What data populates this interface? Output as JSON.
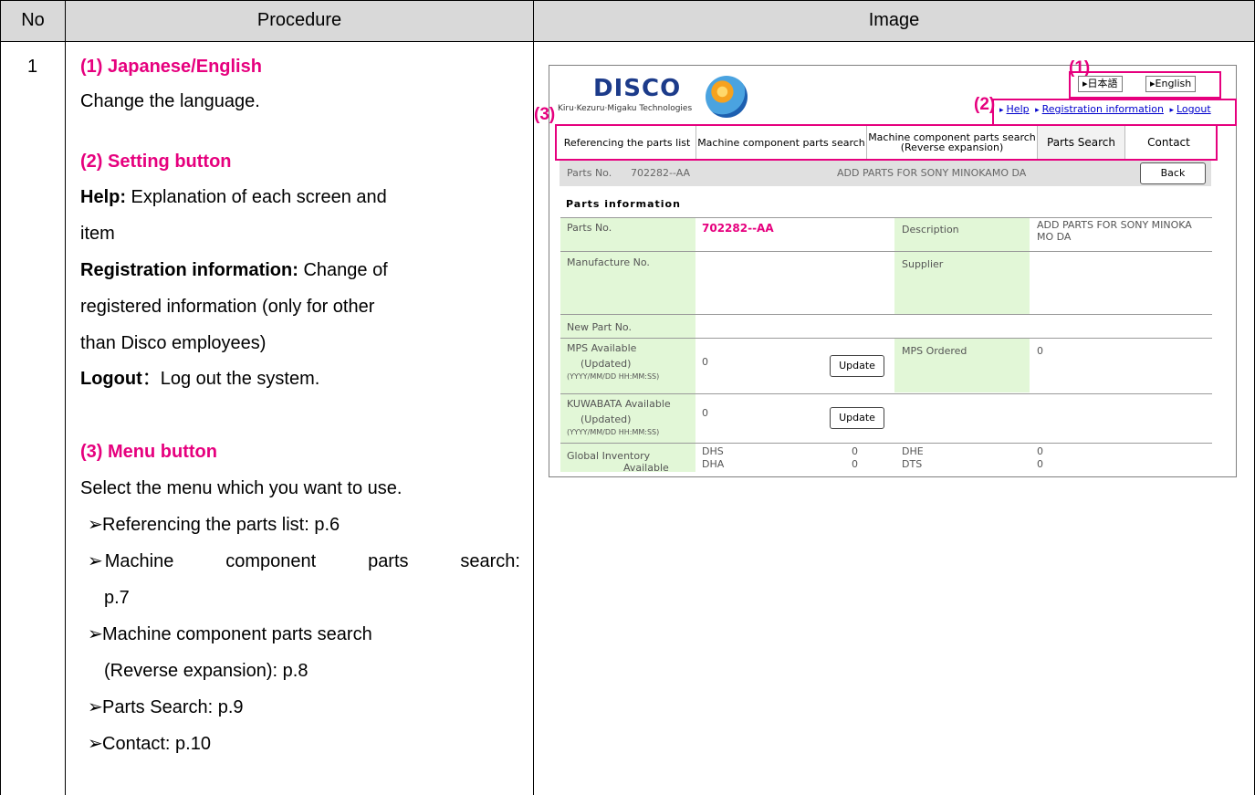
{
  "header": {
    "no": "No",
    "procedure": "Procedure",
    "image": "Image"
  },
  "row": {
    "no": "1",
    "s1_title": "(1) Japanese/English",
    "s1_text": "Change the language.",
    "s2_title": "(2) Setting button",
    "help_label": "Help:",
    "help_text": " Explanation of each screen and",
    "help_text2": "item",
    "reg_label": "Registration information:",
    "reg_text": " Change of",
    "reg_text2": "registered information (only for other",
    "reg_text3": "than Disco employees)",
    "logout_label": "Logout",
    "logout_text": "：Log out the system.",
    "s3_title": "(3) Menu button",
    "s3_text": "Select the menu which you want to use.",
    "items": [
      "Referencing the parts list: p.6",
      "Machine component parts search:",
      "p.7",
      "Machine component parts search",
      "(Reverse expansion): p.8",
      "Parts Search: p.9",
      "Contact: p.10"
    ]
  },
  "screenshot": {
    "logo": "DISCO",
    "tagline": "Kiru·Kezuru·Migaku Technologies",
    "lang_ja": "▸日本語",
    "lang_en": "▸English",
    "links": [
      "Help",
      "Registration information",
      "Logout"
    ],
    "callouts": [
      "(1)",
      "(2)",
      "(3)"
    ],
    "menu": [
      "Referencing the parts list",
      "Machine component parts search",
      "Machine component parts search",
      "(Reverse expansion)",
      "Parts Search",
      "Contact"
    ],
    "bar_parts_label": "Parts No.",
    "bar_parts_no": "702282--AA",
    "bar_desc": "ADD PARTS FOR SONY MINOKAMO DA",
    "back": "Back",
    "section_title": "Parts information",
    "parts_no_label": "Parts No.",
    "parts_no_value": "702282--AA",
    "description_label": "Description",
    "description_value1": "ADD PARTS FOR SONY MINOKA",
    "description_value2": "MO DA",
    "manufacture_label": "Manufacture No.",
    "supplier_label": "Supplier",
    "new_part_label": "New Part No.",
    "mps_label1": "MPS Available",
    "mps_label2": "(Updated)",
    "mps_label3": "(YYYY/MM/DD HH:MM:SS)",
    "mps_value": "0",
    "update": "Update",
    "mps_ordered_label": "MPS Ordered",
    "mps_ordered_value": "0",
    "kuwa_label1": "KUWABATA Available",
    "kuwa_label2": "(Updated)",
    "kuwa_label3": "(YYYY/MM/DD HH:MM:SS)",
    "kuwa_value": "0",
    "global_label1": "Global Inventory",
    "global_label2": "Available",
    "dhs": "DHS",
    "dhs_v": "0",
    "dha": "DHA",
    "dha_v": "0",
    "dhe": "DHE",
    "dhe_v": "0",
    "dts": "DTS",
    "dts_v": "0"
  }
}
